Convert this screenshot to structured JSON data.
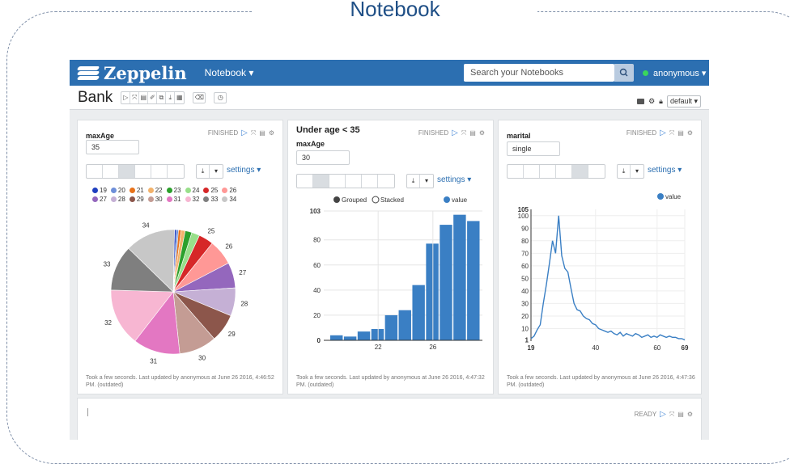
{
  "page_heading": "Notebook",
  "navbar": {
    "brand": "Zeppelin",
    "menu": "Notebook ▾",
    "search_placeholder": "Search your Notebooks",
    "user": "anonymous ▾"
  },
  "toolbar": {
    "title": "Bank",
    "default_label": "default ▾"
  },
  "paragraphs": [
    {
      "title": "",
      "status": "FINISHED",
      "param_label": "maxAge",
      "param_value": "35",
      "settings": "settings ▾",
      "footnote": "Took a few seconds. Last updated by anonymous at June 26 2016, 4:46:52 PM. (outdated)"
    },
    {
      "title": "Under age < 35",
      "status": "FINISHED",
      "param_label": "maxAge",
      "param_value": "30",
      "settings": "settings ▾",
      "footnote": "Took a few seconds. Last updated by anonymous at June 26 2016, 4:47:32 PM. (outdated)"
    },
    {
      "title": "",
      "status": "FINISHED",
      "param_label": "marital",
      "param_value": "single",
      "settings": "settings ▾",
      "footnote": "Took a few seconds. Last updated by anonymous at June 26 2016, 4:47:36 PM. (outdated)"
    },
    {
      "status": "READY"
    }
  ],
  "chart_data": [
    {
      "type": "pie",
      "categories": [
        "19",
        "20",
        "21",
        "22",
        "23",
        "24",
        "25",
        "26",
        "27",
        "28",
        "29",
        "30",
        "31",
        "32",
        "33",
        "34"
      ],
      "values": [
        0.3,
        0.3,
        0.4,
        0.6,
        1.0,
        1.2,
        2.2,
        3.8,
        3.8,
        4.2,
        4.2,
        5.6,
        7.0,
        8.6,
        6.8,
        7.5
      ],
      "colors": [
        "#1f3fbf",
        "#6e8fd9",
        "#e8721a",
        "#f2b26b",
        "#2ca02c",
        "#98df8a",
        "#d62728",
        "#ff9896",
        "#9467bd",
        "#c5b0d5",
        "#8c564b",
        "#c49c94",
        "#e377c2",
        "#f7b6d2",
        "#7f7f7f",
        "#c7c7c7"
      ]
    },
    {
      "type": "bar",
      "legend": [
        "Grouped",
        "Stacked",
        "value"
      ],
      "categories": [
        "19",
        "20",
        "21",
        "22",
        "23",
        "24",
        "25",
        "26",
        "27",
        "28",
        "29"
      ],
      "values": [
        4,
        3,
        7,
        9,
        20,
        24,
        44,
        77,
        92,
        100,
        95
      ],
      "ylim": [
        0,
        103
      ],
      "yticks": [
        "0",
        "20",
        "40",
        "60",
        "80",
        "103"
      ],
      "xticks": [
        "22",
        "26"
      ]
    },
    {
      "type": "line",
      "legend": [
        "value"
      ],
      "x": [
        19,
        20,
        21,
        22,
        23,
        24,
        25,
        26,
        27,
        28,
        29,
        30,
        31,
        32,
        33,
        34,
        35,
        36,
        37,
        38,
        39,
        40,
        41,
        42,
        43,
        44,
        45,
        46,
        47,
        48,
        49,
        50,
        51,
        52,
        53,
        54,
        55,
        56,
        57,
        58,
        59,
        60,
        61,
        62,
        63,
        64,
        65,
        66,
        67,
        68,
        69
      ],
      "y": [
        2,
        4,
        9,
        13,
        30,
        45,
        62,
        80,
        70,
        100,
        68,
        58,
        55,
        42,
        30,
        25,
        24,
        20,
        18,
        17,
        14,
        13,
        10,
        9,
        8,
        7,
        8,
        6,
        5,
        7,
        4,
        6,
        5,
        4,
        6,
        5,
        3,
        4,
        5,
        3,
        4,
        3,
        5,
        4,
        3,
        4,
        3,
        3,
        2,
        2,
        1
      ],
      "ylim": [
        0,
        105
      ],
      "yticks": [
        "1",
        "10",
        "20",
        "30",
        "40",
        "50",
        "60",
        "70",
        "80",
        "90",
        "100",
        "105"
      ],
      "xticks": [
        "19",
        "40",
        "60",
        "69"
      ]
    }
  ]
}
